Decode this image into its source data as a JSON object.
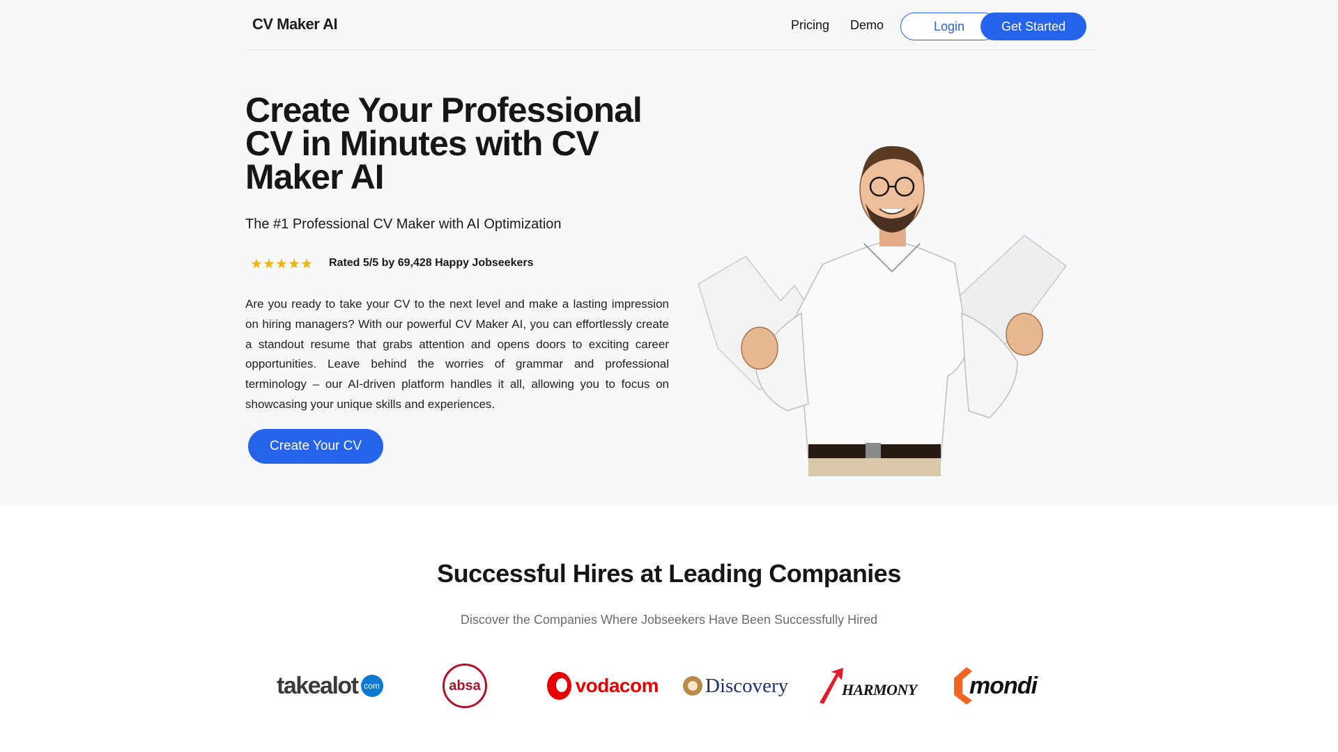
{
  "header": {
    "brand": "CV Maker AI",
    "nav": {
      "pricing": "Pricing",
      "demo": "Demo"
    },
    "login_label": "Login",
    "get_started_label": "Get Started"
  },
  "hero": {
    "title": "Create Your Professional CV in Minutes with CV Maker AI",
    "subtitle": "The #1 Professional CV Maker with AI Optimization",
    "rating": {
      "stars": 5,
      "text": "Rated 5/5 by 69,428 Happy Jobseekers"
    },
    "description": "Are you ready to take your CV to the next level and make a lasting impression on hiring managers? With our powerful CV Maker AI, you can effortlessly create a standout resume that grabs attention and opens doors to exciting career opportunities. Leave behind the worries of grammar and professional terminology – our AI-driven platform handles it all, allowing you to focus on showcasing your unique skills and experiences.",
    "cta_label": "Create Your CV"
  },
  "companies": {
    "title": "Successful Hires at Leading Companies",
    "subtitle": "Discover the Companies Where Jobseekers Have Been Successfully Hired",
    "logos": [
      {
        "name": "takealot",
        "suffix": "com"
      },
      {
        "name": "absa"
      },
      {
        "name": "vodacom"
      },
      {
        "name": "Discovery"
      },
      {
        "name": "HARMONY"
      },
      {
        "name": "mondi"
      }
    ]
  },
  "colors": {
    "accent": "#2563eb",
    "star": "#f5b301",
    "hero_bg": "#f7f8fa",
    "takealot_badge": "#0b79d0",
    "absa_red": "#b0102a",
    "vodacom_red": "#e60000",
    "discovery_navy": "#1d2f6f",
    "harmony_red": "#e11d2b",
    "mondi_orange": "#f26522"
  },
  "icons": {
    "rating": "star-icon",
    "illustration": "businessman-holding-documents-illustration"
  }
}
